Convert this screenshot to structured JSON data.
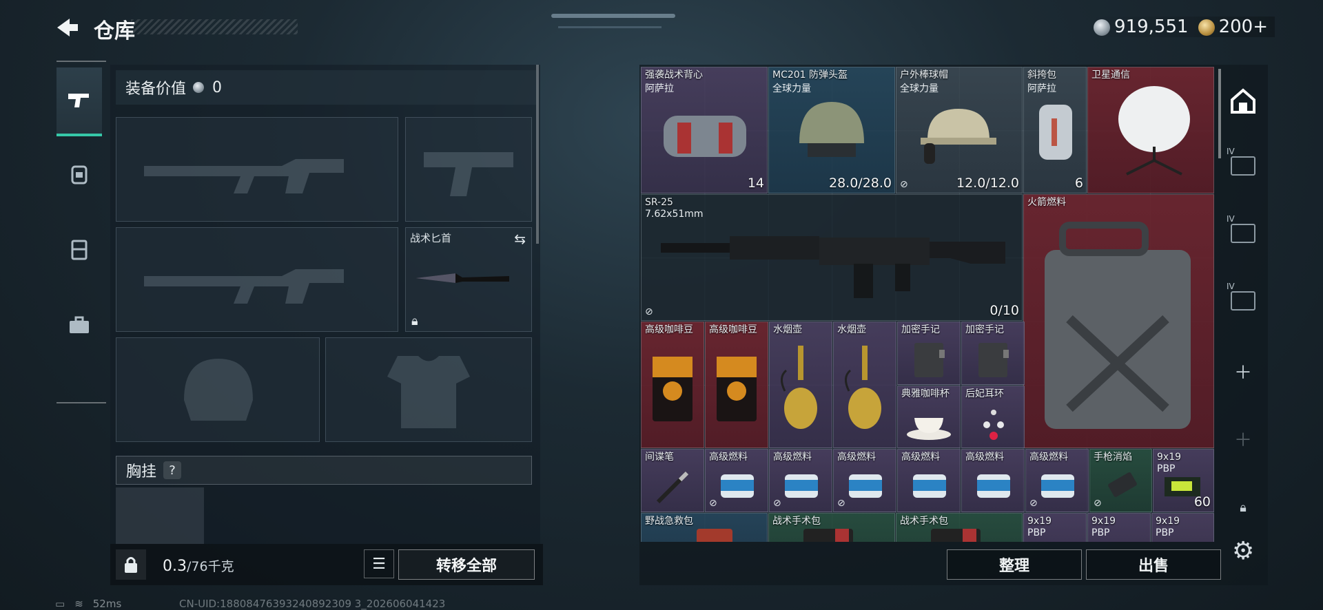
{
  "header": {
    "title": "仓库",
    "silver_amount": "919,551",
    "gold_amount": "200+"
  },
  "left_tabs": [
    {
      "name": "pistol-icon",
      "active": true
    },
    {
      "name": "backpack-icon",
      "active": false
    },
    {
      "name": "vest-icon",
      "active": false
    },
    {
      "name": "briefcase-icon",
      "active": false
    }
  ],
  "equipment": {
    "value_label": "装备价值",
    "value": "0",
    "melee_label": "战术匕首",
    "chest_label": "胸挂",
    "chest_help": "?"
  },
  "bottom_left": {
    "weight_current": "0.3",
    "weight_max": "/76千克",
    "transfer_all": "转移全部"
  },
  "stash_items": [
    {
      "name": "强袭战术背心",
      "sub": "阿萨拉",
      "count": "14",
      "color": "purple"
    },
    {
      "name": "MC201 防弹头盔",
      "sub": "全球力量",
      "count": "28.0/28.0",
      "color": "blue"
    },
    {
      "name": "户外棒球帽",
      "sub": "全球力量",
      "count": "12.0/12.0",
      "color": "gray"
    },
    {
      "name": "斜挎包",
      "sub": "阿萨拉",
      "count": "6",
      "color": "gray"
    },
    {
      "name": "卫星通信",
      "sub": "",
      "count": "",
      "color": "red"
    },
    {
      "name": "SR-25",
      "sub": "7.62x51mm",
      "count": "0/10",
      "color": "dark"
    },
    {
      "name": "火箭燃料",
      "sub": "",
      "count": "",
      "color": "red"
    },
    {
      "name": "高级咖啡豆",
      "color": "red"
    },
    {
      "name": "高级咖啡豆",
      "color": "red"
    },
    {
      "name": "水烟壶",
      "color": "purple"
    },
    {
      "name": "水烟壶",
      "color": "purple"
    },
    {
      "name": "加密手记",
      "color": "purple"
    },
    {
      "name": "加密手记",
      "color": "purple"
    },
    {
      "name": "典雅咖啡杯",
      "color": "purple"
    },
    {
      "name": "后妃耳环",
      "color": "purple"
    },
    {
      "name": "间谍笔",
      "color": "purple"
    },
    {
      "name": "高级燃料",
      "color": "purple"
    },
    {
      "name": "高级燃料",
      "color": "purple"
    },
    {
      "name": "高级燃料",
      "color": "purple"
    },
    {
      "name": "高级燃料",
      "color": "purple"
    },
    {
      "name": "高级燃料",
      "color": "purple"
    },
    {
      "name": "高级燃料",
      "color": "purple"
    },
    {
      "name": "手枪消焰",
      "color": "green"
    },
    {
      "name": "9x19",
      "sub": "PBP",
      "count": "60",
      "color": "purple"
    },
    {
      "name": "野战急救包",
      "color": "blue"
    },
    {
      "name": "战术手术包",
      "color": "green"
    },
    {
      "name": "战术手术包",
      "color": "green"
    },
    {
      "name": "9x19",
      "sub": "PBP",
      "color": "purple"
    },
    {
      "name": "9x19",
      "sub": "PBP",
      "color": "purple"
    },
    {
      "name": "9x19",
      "sub": "PBP",
      "color": "purple"
    }
  ],
  "actions": {
    "sort": "整理",
    "sell": "出售"
  },
  "status": {
    "ping": "52ms",
    "uid": "CN-UID:18808476393240892309 3_202606041423"
  },
  "colors": {
    "accent": "#36c8a8",
    "rare_red": "#701e2c",
    "epic_purple": "#4e4264",
    "blue": "#284a60"
  }
}
